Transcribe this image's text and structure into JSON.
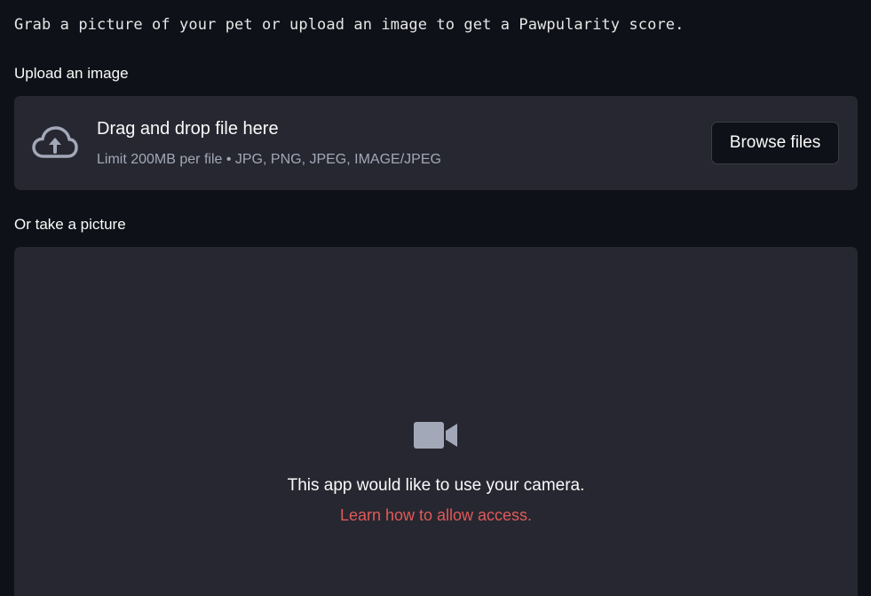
{
  "intro": {
    "text": "Grab a picture of your pet or upload an image to get a Pawpularity score."
  },
  "upload": {
    "label": "Upload an image",
    "dropzone_title": "Drag and drop file here",
    "dropzone_hint": "Limit 200MB per file • JPG, PNG, JPEG, IMAGE/JPEG",
    "browse_label": "Browse files",
    "icon": "cloud-upload-icon"
  },
  "camera": {
    "label": "Or take a picture",
    "message": "This app would like to use your camera.",
    "link_text": "Learn how to allow access.",
    "icon": "video-camera-icon"
  },
  "colors": {
    "background": "#0e1117",
    "panel": "#262730",
    "link": "#e05a5a",
    "muted_text": "#a3a8b8"
  }
}
